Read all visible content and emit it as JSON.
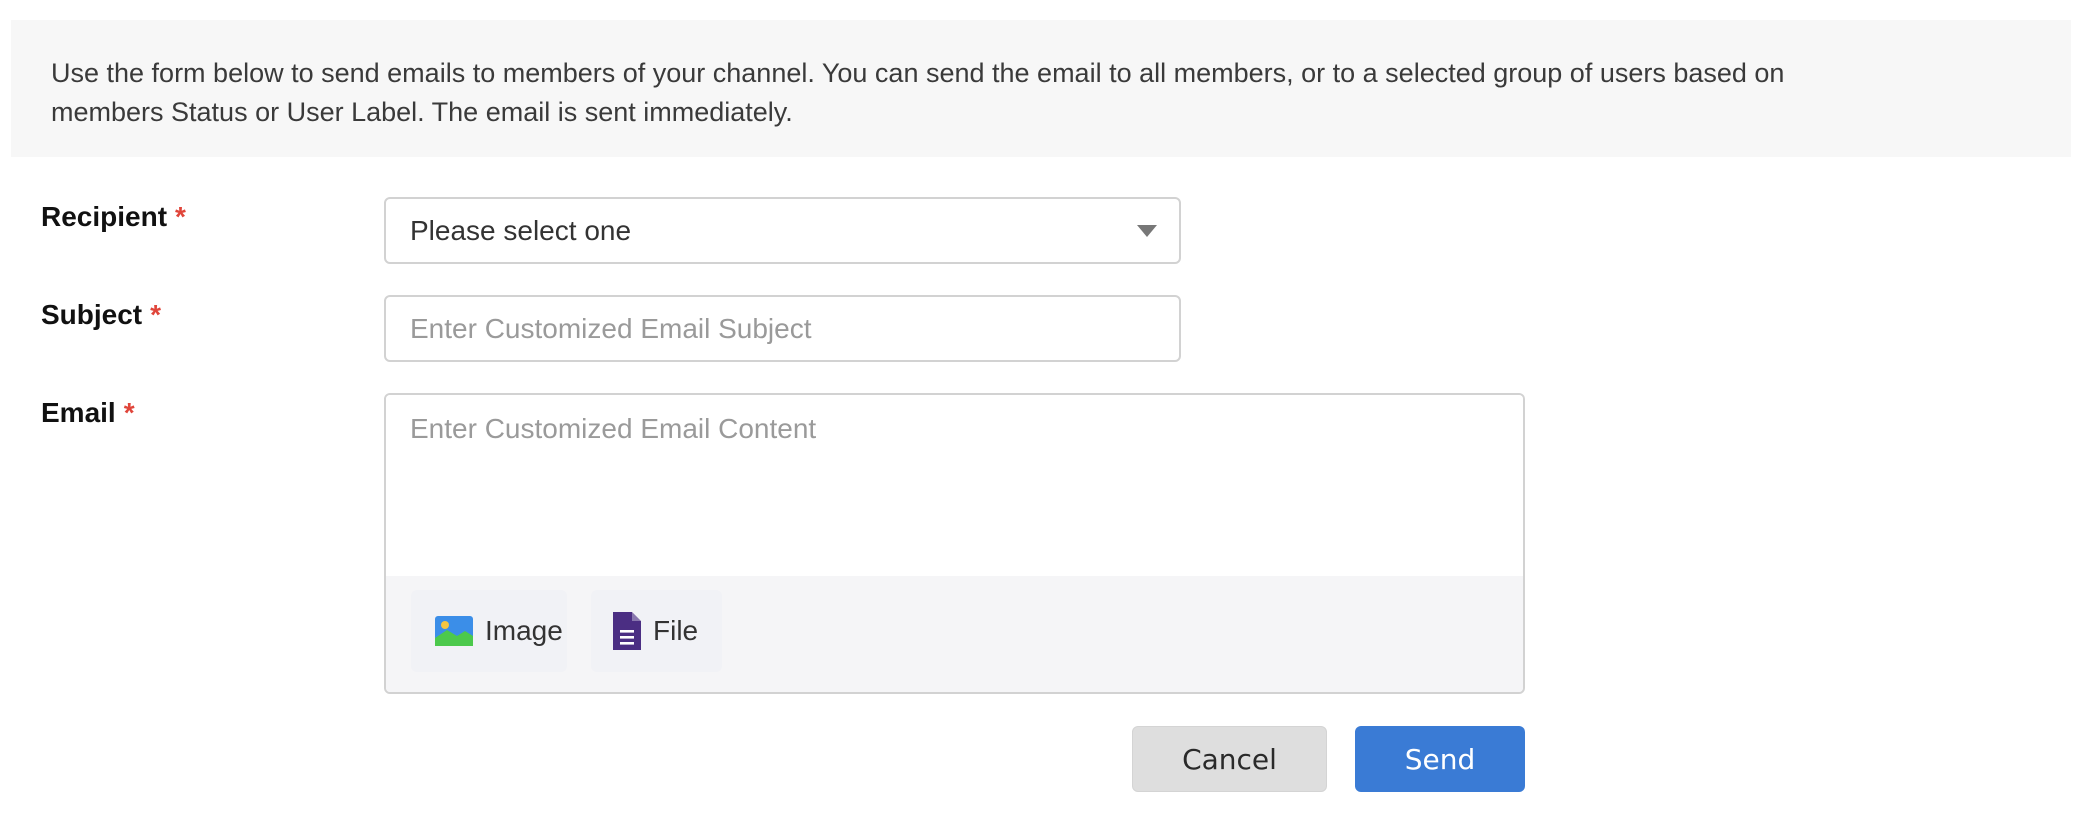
{
  "info": {
    "line1": "Use the form below to send emails to members of your channel. You can send the email to all members, or to a selected group of users based on",
    "line2": "members Status or User Label. The email is sent immediately."
  },
  "form": {
    "recipient": {
      "label": "Recipient",
      "required_mark": "*",
      "selected_value": "Please select one"
    },
    "subject": {
      "label": "Subject",
      "required_mark": "*",
      "placeholder": "Enter Customized Email Subject",
      "value": ""
    },
    "email": {
      "label": "Email",
      "required_mark": "*",
      "placeholder": "Enter Customized Email Content",
      "value": ""
    }
  },
  "attachments": {
    "image_label": "Image",
    "file_label": "File",
    "image_icon": "image-icon",
    "file_icon": "file-icon"
  },
  "actions": {
    "cancel_label": "Cancel",
    "send_label": "Send"
  },
  "colors": {
    "required": "#e0453a",
    "primary": "#3a7bd5",
    "file_icon": "#4b2e83",
    "image_icon_bg": "#3b8ee8",
    "image_icon_hill": "#4cc94c"
  }
}
